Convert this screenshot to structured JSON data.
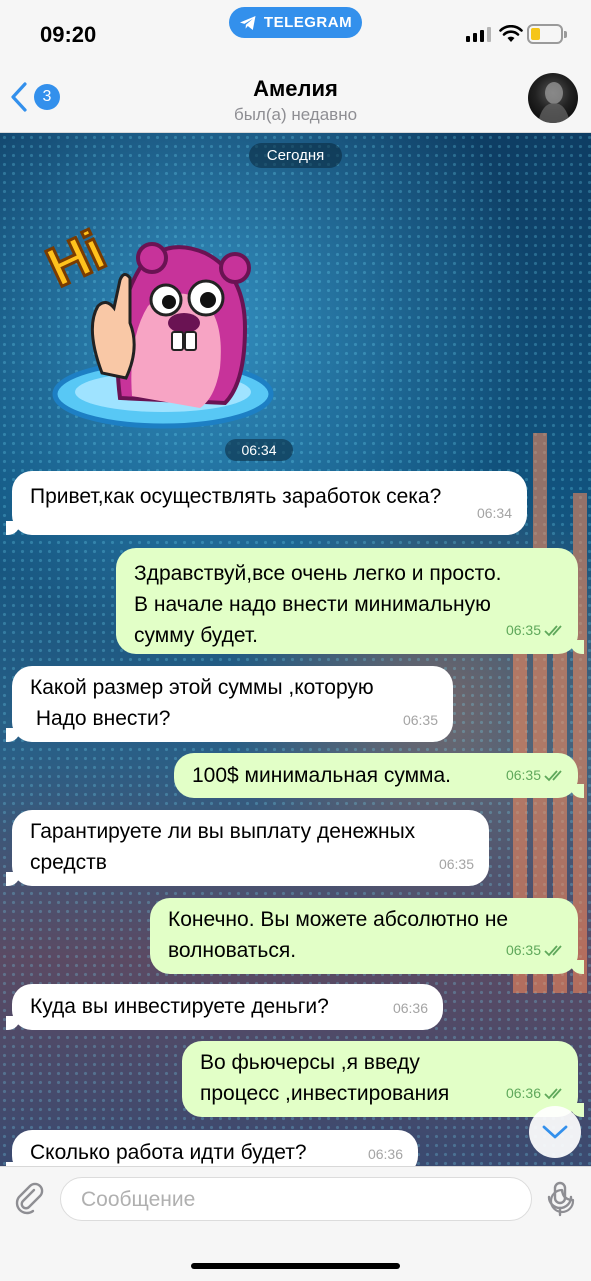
{
  "status": {
    "time": "09:20",
    "app_pill": "TELEGRAM"
  },
  "header": {
    "back_count": "3",
    "title": "Амелия",
    "subtitle": "был(а) недавно"
  },
  "chat": {
    "date_label": "Сегодня",
    "sticker": {
      "text": "Hi",
      "time": "06:34"
    },
    "messages": [
      {
        "dir": "in",
        "text": "Привет,как осуществлять заработок сека?",
        "time": "06:34"
      },
      {
        "dir": "out",
        "text": "Здравствуй,все очень легко и просто.\nВ начале надо внести минимальную\nсумму будет.",
        "time": "06:35"
      },
      {
        "dir": "in",
        "text": "Какой размер этой суммы ,которую\n Надо внести?",
        "time": "06:35"
      },
      {
        "dir": "out",
        "text": "100$ минимальная сумма.",
        "time": "06:35"
      },
      {
        "dir": "in",
        "text": "Гарантируете ли вы выплату денежных\nсредств",
        "time": "06:35"
      },
      {
        "dir": "out",
        "text": "Конечно. Вы можете абсолютно не\nволноваться.",
        "time": "06:35"
      },
      {
        "dir": "in",
        "text": "Куда вы инвестируете деньги?",
        "time": "06:36"
      },
      {
        "dir": "out",
        "text": "Во фьючерсы ,я введу\nпроцесс ,инвестирования",
        "time": "06:36"
      },
      {
        "dir": "in",
        "text": "Сколько работа идти будет?",
        "time": "06:36"
      }
    ]
  },
  "input": {
    "placeholder": "Сообщение"
  },
  "colors": {
    "accent": "#3390ec",
    "outgoing_bubble": "#e2ffc7",
    "incoming_bubble": "#ffffff",
    "read_check": "#5fa85b"
  }
}
